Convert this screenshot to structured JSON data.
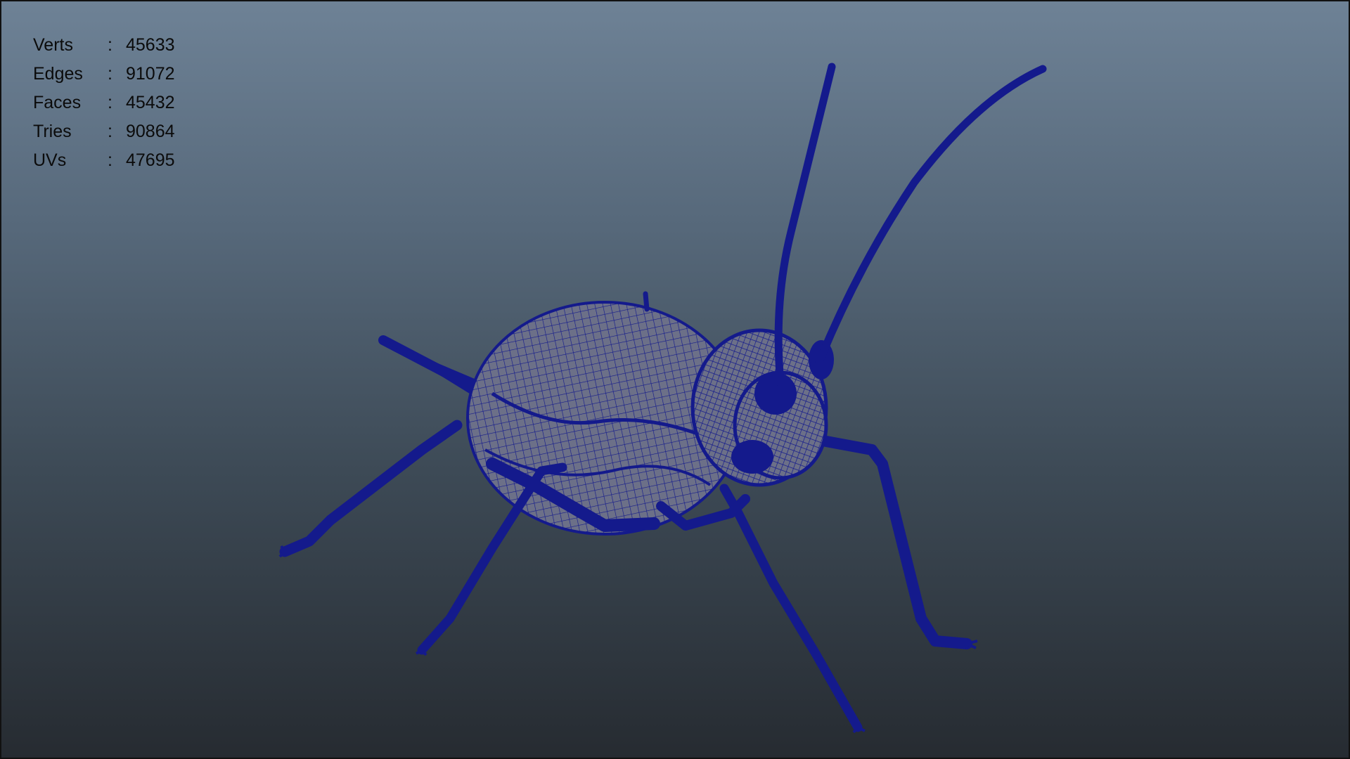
{
  "hud": {
    "rows": [
      {
        "label": "Verts",
        "colon": ":",
        "value": "45633"
      },
      {
        "label": "Edges",
        "colon": ":",
        "value": "91072"
      },
      {
        "label": "Faces",
        "colon": ":",
        "value": "45432"
      },
      {
        "label": "Tries",
        "colon": ":",
        "value": "90864"
      },
      {
        "label": "UVs",
        "colon": ":",
        "value": "47695"
      }
    ]
  },
  "colors": {
    "wire": "#141a8c",
    "body_fill": "#6c7088",
    "body_shadow": "#4d5168",
    "text": "#0b0b0b"
  }
}
